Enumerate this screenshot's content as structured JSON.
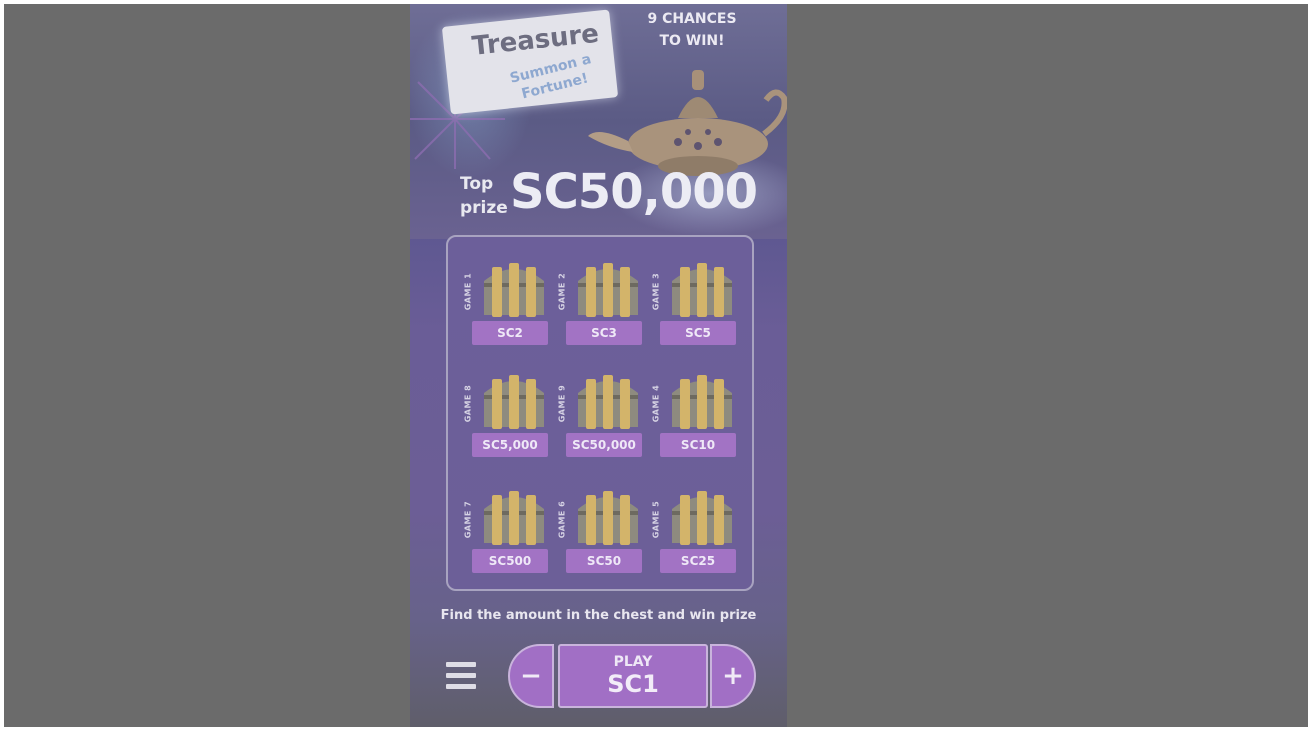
{
  "header": {
    "title": "Treasure",
    "subtitle": "Summon a Fortune!",
    "chances": "9 CHANCES TO WIN!",
    "top_prize_label": "Top prize",
    "top_prize_value": "SC50,000"
  },
  "board": {
    "cells": [
      {
        "game": "GAME 1",
        "prize": "SC2"
      },
      {
        "game": "GAME 2",
        "prize": "SC3"
      },
      {
        "game": "GAME 3",
        "prize": "SC5"
      },
      {
        "game": "GAME 8",
        "prize": "SC5,000"
      },
      {
        "game": "GAME 9",
        "prize": "SC50,000"
      },
      {
        "game": "GAME 4",
        "prize": "SC10"
      },
      {
        "game": "GAME 7",
        "prize": "SC500"
      },
      {
        "game": "GAME 6",
        "prize": "SC50"
      },
      {
        "game": "GAME 5",
        "prize": "SC25"
      }
    ]
  },
  "hint": "Find the amount in the chest and win prize",
  "controls": {
    "minus": "−",
    "plus": "+",
    "play_label": "PLAY",
    "play_amount": "SC1"
  },
  "colors": {
    "overlay": "#6b6b6b",
    "accent": "#a16fc5",
    "board": "#6c5f9a"
  },
  "icons": [
    "menu-icon",
    "chest-icon",
    "magic-lamp-icon",
    "firework-icon"
  ]
}
